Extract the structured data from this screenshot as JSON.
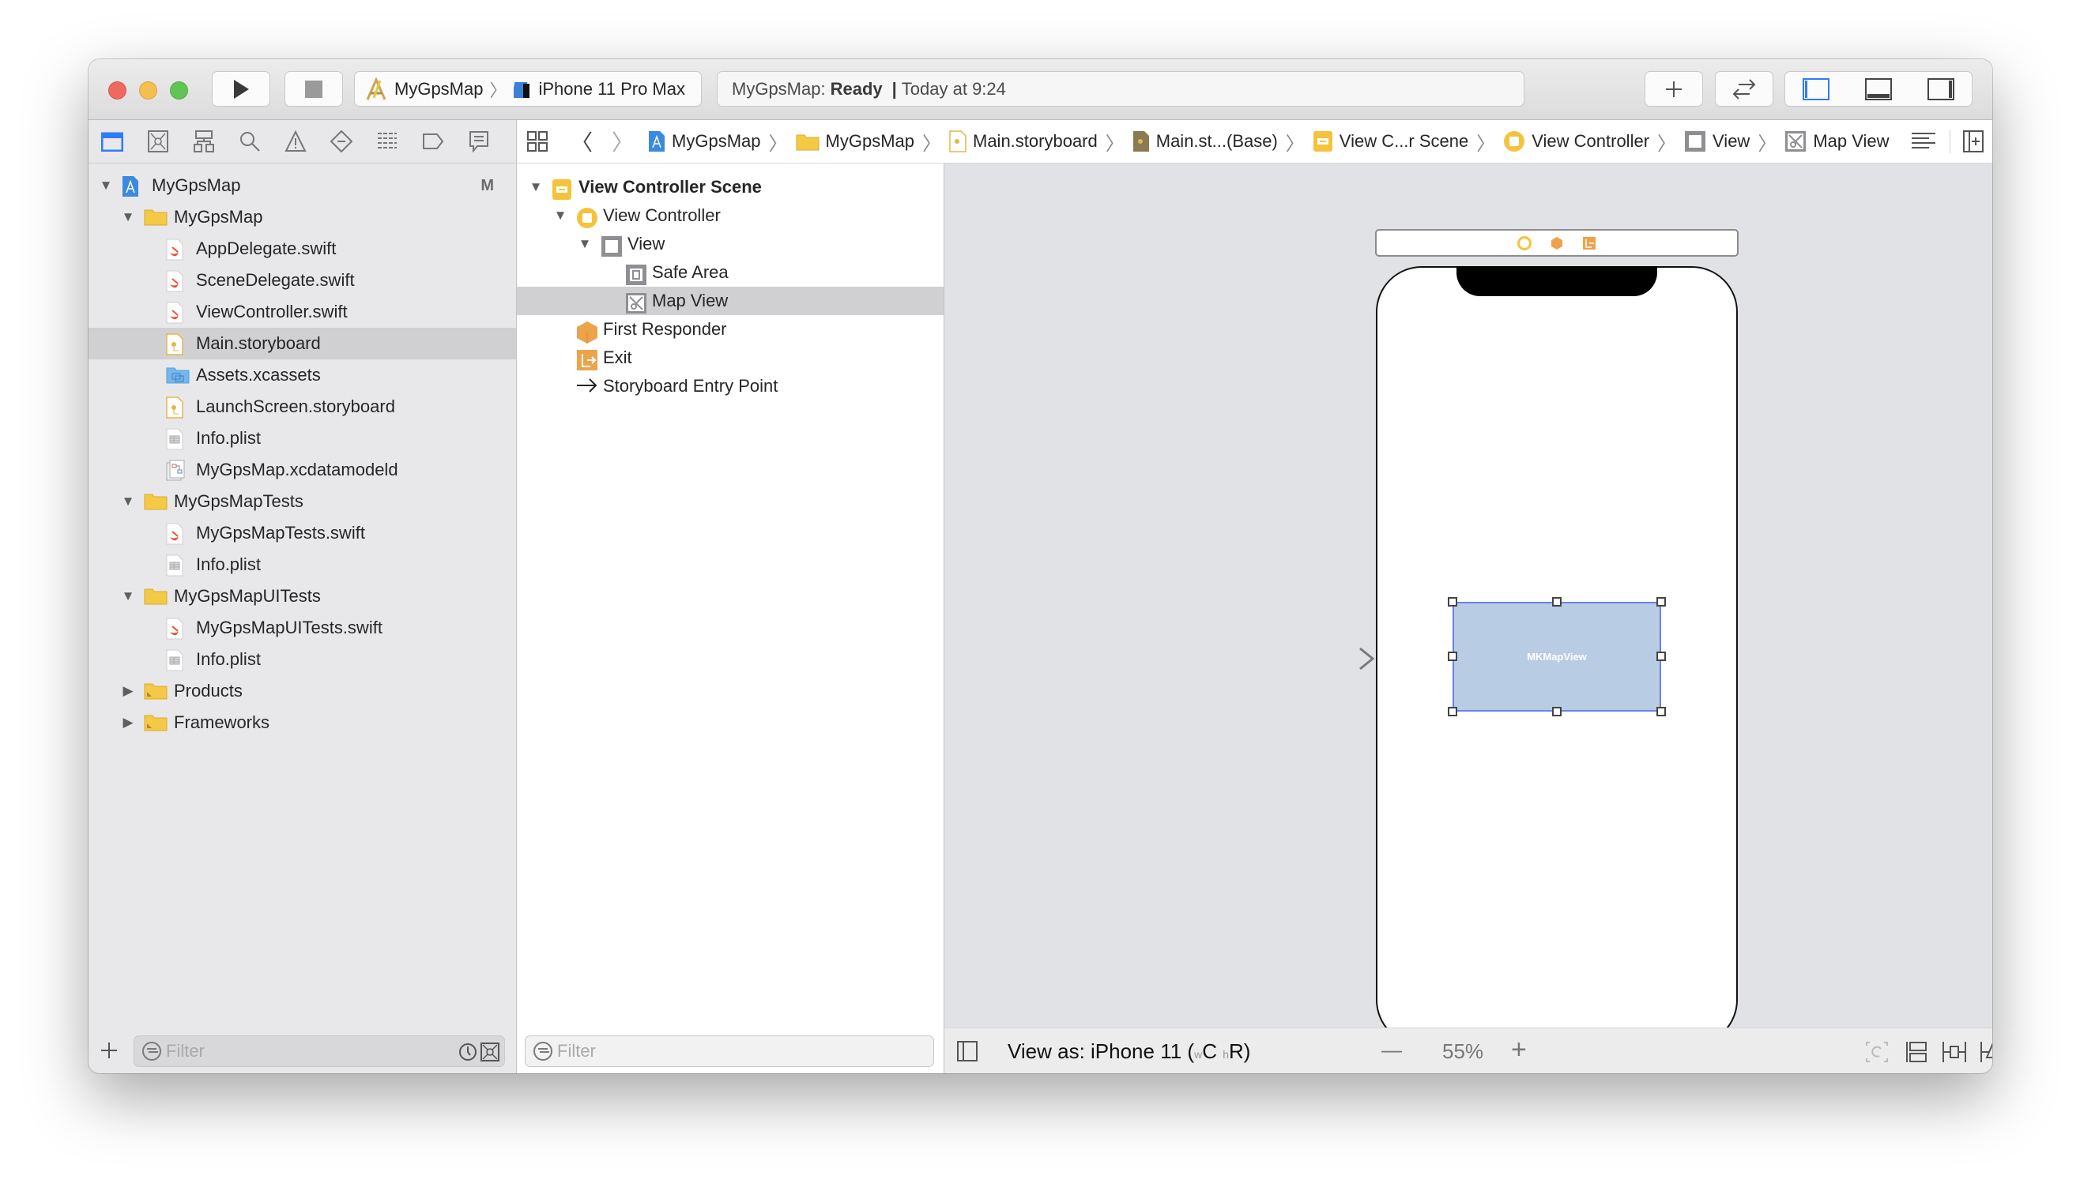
{
  "toolbar": {
    "scheme_target": "MyGpsMap",
    "scheme_device": "iPhone 11 Pro Max",
    "activity_project": "MyGpsMap:",
    "activity_status": "Ready",
    "activity_sep": "|",
    "activity_time": "Today at 9:24",
    "buttons": [
      "run",
      "stop",
      "library",
      "code-review",
      "toggle-navigator",
      "toggle-debug-area",
      "toggle-inspectors"
    ]
  },
  "navigator_tabs": [
    "project-navigator",
    "source-control-navigator",
    "symbol-navigator",
    "find-navigator",
    "issue-navigator",
    "test-navigator",
    "debug-navigator",
    "breakpoint-navigator",
    "report-navigator"
  ],
  "jumpbar": {
    "crumbs": [
      "MyGpsMap",
      "MyGpsMap",
      "Main.storyboard",
      "Main.st...(Base)",
      "View C...r Scene",
      "View Controller",
      "View",
      "Map View"
    ]
  },
  "project_tree": [
    {
      "label": "MyGpsMap",
      "icon": "project",
      "level": 0,
      "expanded": true,
      "badge": "M"
    },
    {
      "label": "MyGpsMap",
      "icon": "folder",
      "level": 1,
      "expanded": true
    },
    {
      "label": "AppDelegate.swift",
      "icon": "swift",
      "level": 2
    },
    {
      "label": "SceneDelegate.swift",
      "icon": "swift",
      "level": 2
    },
    {
      "label": "ViewController.swift",
      "icon": "swift",
      "level": 2
    },
    {
      "label": "Main.storyboard",
      "icon": "storyboard",
      "level": 2,
      "selected": true
    },
    {
      "label": "Assets.xcassets",
      "icon": "assets",
      "level": 2
    },
    {
      "label": "LaunchScreen.storyboard",
      "icon": "storyboard",
      "level": 2
    },
    {
      "label": "Info.plist",
      "icon": "plist",
      "level": 2
    },
    {
      "label": "MyGpsMap.xcdatamodeld",
      "icon": "datamodel",
      "level": 2
    },
    {
      "label": "MyGpsMapTests",
      "icon": "folder",
      "level": 1,
      "expanded": true
    },
    {
      "label": "MyGpsMapTests.swift",
      "icon": "swift",
      "level": 2
    },
    {
      "label": "Info.plist",
      "icon": "plist",
      "level": 2
    },
    {
      "label": "MyGpsMapUITests",
      "icon": "folder",
      "level": 1,
      "expanded": true
    },
    {
      "label": "MyGpsMapUITests.swift",
      "icon": "swift",
      "level": 2
    },
    {
      "label": "Info.plist",
      "icon": "plist",
      "level": 2
    },
    {
      "label": "Products",
      "icon": "folder-special",
      "level": 1,
      "expanded": false
    },
    {
      "label": "Frameworks",
      "icon": "folder-special",
      "level": 1,
      "expanded": false
    }
  ],
  "document_outline": [
    {
      "label": "View Controller Scene",
      "icon": "scene",
      "level": 0,
      "expanded": true,
      "bold": true
    },
    {
      "label": "View Controller",
      "icon": "view-controller",
      "level": 1,
      "expanded": true
    },
    {
      "label": "View",
      "icon": "view",
      "level": 2,
      "expanded": true
    },
    {
      "label": "Safe Area",
      "icon": "safe-area",
      "level": 3
    },
    {
      "label": "Map View",
      "icon": "map-view",
      "level": 3,
      "selected": true
    },
    {
      "label": "First Responder",
      "icon": "first-responder",
      "level": 1
    },
    {
      "label": "Exit",
      "icon": "exit",
      "level": 1
    },
    {
      "label": "Storyboard Entry Point",
      "icon": "entry-arrow",
      "level": 1
    }
  ],
  "canvas": {
    "map_view_label": "MKMapView"
  },
  "filters": {
    "navigator_placeholder": "Filter",
    "outline_placeholder": "Filter"
  },
  "bottom_bar": {
    "view_as_prefix": "View as: iPhone 11 (",
    "w_label": "w",
    "w_value": "C",
    "h_label": "h",
    "h_value": "R",
    "close_paren": ")",
    "zoom_minus": "—",
    "zoom_level": "55%",
    "zoom_plus": "+"
  },
  "colors": {
    "accent": "#2f7cf6",
    "selection": "#d0d0d2",
    "map_fill": "#b8cce4",
    "map_border": "#6a83e6",
    "storyboard_yellow": "#f5c33b",
    "responder_orange": "#eda34a"
  }
}
